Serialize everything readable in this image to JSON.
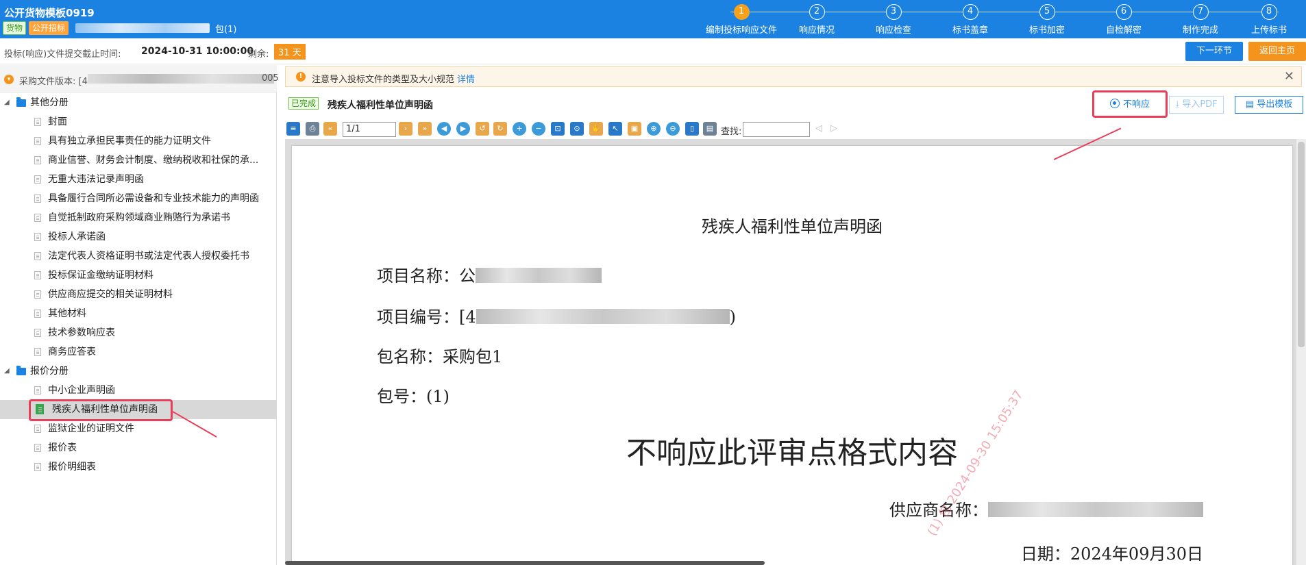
{
  "header": {
    "title": "公开货物模板0919",
    "tag_goods": "货物",
    "tag_tender": "公开招标",
    "package": "包(1)",
    "steps": [
      {
        "num": "1",
        "label": "编制投标响应文件",
        "active": true
      },
      {
        "num": "2",
        "label": "响应情况",
        "active": false
      },
      {
        "num": "3",
        "label": "响应检查",
        "active": false
      },
      {
        "num": "4",
        "label": "标书盖章",
        "active": false
      },
      {
        "num": "5",
        "label": "标书加密",
        "active": false
      },
      {
        "num": "6",
        "label": "自检解密",
        "active": false
      },
      {
        "num": "7",
        "label": "制作完成",
        "active": false
      },
      {
        "num": "8",
        "label": "上传标书",
        "active": false
      }
    ]
  },
  "deadline": {
    "label": "投标(响应)文件提交截止时间:",
    "time": "2024-10-31 10:00:00",
    "remain_label": "剩余:",
    "remain_days": "31 天",
    "next_button": "下一环节",
    "home_button": "返回主页"
  },
  "sidebar": {
    "version_label": "采购文件版本: [4",
    "version_tail": "005",
    "groups": [
      {
        "label": "其他分册",
        "items": [
          "封面",
          "具有独立承担民事责任的能力证明文件",
          "商业信誉、财务会计制度、缴纳税收和社保的承...",
          "无重大违法记录声明函",
          "具备履行合同所必需设备和专业技术能力的声明函",
          "自觉抵制政府采购领域商业贿赂行为承诺书",
          "投标人承诺函",
          "法定代表人资格证明书或法定代表人授权委托书",
          "投标保证金缴纳证明材料",
          "供应商应提交的相关证明材料",
          "其他材料",
          "技术参数响应表",
          "商务应答表"
        ]
      },
      {
        "label": "报价分册",
        "items": [
          "中小企业声明函",
          "残疾人福利性单位声明函",
          "监狱企业的证明文件",
          "报价表",
          "报价明细表"
        ]
      }
    ]
  },
  "notice": {
    "text": "注意导入投标文件的类型及大小规范",
    "link": "详情"
  },
  "doc": {
    "status": "已完成",
    "name": "残疾人福利性单位声明函",
    "no_response": "不响应",
    "import_pdf": "导入PDF",
    "export_template": "导出模板"
  },
  "toolbar": {
    "page_value": "1/1",
    "find_label": "查找:"
  },
  "page": {
    "title": "残疾人福利性单位声明函",
    "project_name_label": "项目名称：公",
    "project_no_label": "项目编号：[4",
    "project_no_tail": ")",
    "package_name": "包名称：采购包1",
    "package_no": "包号：(1)",
    "big_text": "不响应此评审点格式内容",
    "supplier_label": "供应商名称：",
    "date": "日期：2024年09月30日",
    "watermark": "(1) 包 2024-09-30 15:05:37"
  },
  "colors": {
    "primary": "#1c82e2",
    "accent": "#f5941d",
    "highlight": "#e83e58"
  }
}
